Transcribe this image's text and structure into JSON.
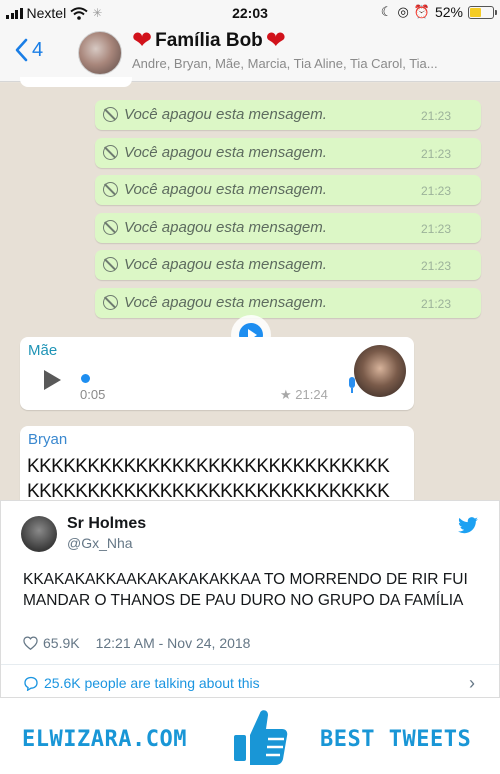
{
  "status_bar": {
    "carrier": "Nextel",
    "time": "22:03",
    "battery": "52%",
    "battery_level": 0.52
  },
  "chat_header": {
    "back_count": "4",
    "group_name": "Família Bob",
    "members": "Andre, Bryan, Mãe, Marcia, Tia Aline, Tia Carol, Tia..."
  },
  "deleted_messages": [
    {
      "text": "Você apagou esta mensagem.",
      "time": "21:23"
    },
    {
      "text": "Você apagou esta mensagem.",
      "time": "21:23"
    },
    {
      "text": "Você apagou esta mensagem.",
      "time": "21:23"
    },
    {
      "text": "Você apagou esta mensagem.",
      "time": "21:23"
    },
    {
      "text": "Você apagou esta mensagem.",
      "time": "21:23"
    },
    {
      "text": "Você apagou esta mensagem.",
      "time": "21:23"
    }
  ],
  "voice_message": {
    "sender": "Mãe",
    "duration": "0:05",
    "time": "★ 21:24"
  },
  "text_message": {
    "sender": "Bryan",
    "line1": "KKKKKKKKKKKKKKKKKKKKKKKKKKKKKK",
    "line2": "KKKKKKKKKKKKKKKKKKKKKKKKKKKKKK"
  },
  "tweet": {
    "name": "Sr Holmes",
    "handle": "@Gx_Nha",
    "text": "KKAKAKAKKAAKAKAKAKAKKAA TO MORRENDO DE RIR FUI MANDAR O THANOS DE PAU DURO NO GRUPO DA FAMÍLIA",
    "likes": "65.9K",
    "timestamp": "12:21 AM - Nov 24, 2018",
    "talking": "25.6K people are talking about this"
  },
  "footer": {
    "brand": "ELWIZARA.COM",
    "tagline": "BEST TWEETS"
  },
  "colors": {
    "twitter_blue": "#1b95e0",
    "brand_blue": "#1996d6",
    "deleted_bubble": "#dcf7c6",
    "heart_red": "#d1121b"
  },
  "icons": [
    "signal-icon",
    "wifi-icon",
    "battery-icon",
    "back-chevron-icon",
    "heart-icon",
    "ban-icon",
    "play-icon",
    "mic-icon",
    "twitter-bird-icon",
    "like-icon",
    "comment-icon",
    "chevron-right-icon",
    "thumbs-up-icon"
  ]
}
